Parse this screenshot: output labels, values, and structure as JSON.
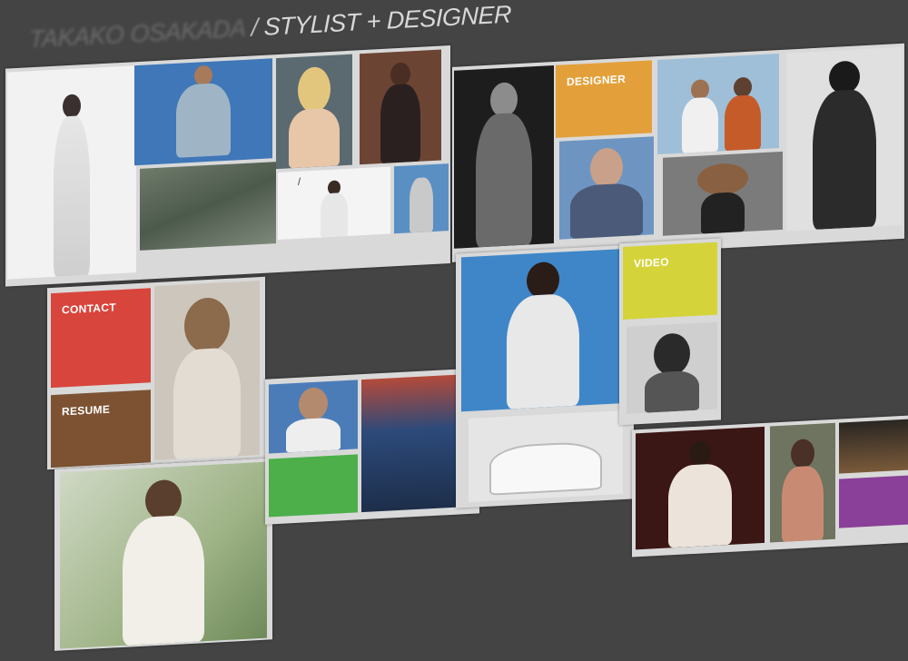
{
  "header": {
    "name": "TAKAKO OSAKADA",
    "separator": "/",
    "role": "STYLIST + DESIGNER"
  },
  "nav_tiles": {
    "designer": {
      "label": "DESIGNER",
      "color": "#e3a03a"
    },
    "contact": {
      "label": "CONTACT",
      "color": "#d8453c"
    },
    "resume": {
      "label": "RESUME",
      "color": "#7c5232"
    },
    "video": {
      "label": "VIDEO",
      "color": "#d4d33a"
    },
    "green": {
      "color": "#4caf4a"
    },
    "purple": {
      "color": "#8a3f98"
    }
  },
  "photo_tile_glyph": "/"
}
